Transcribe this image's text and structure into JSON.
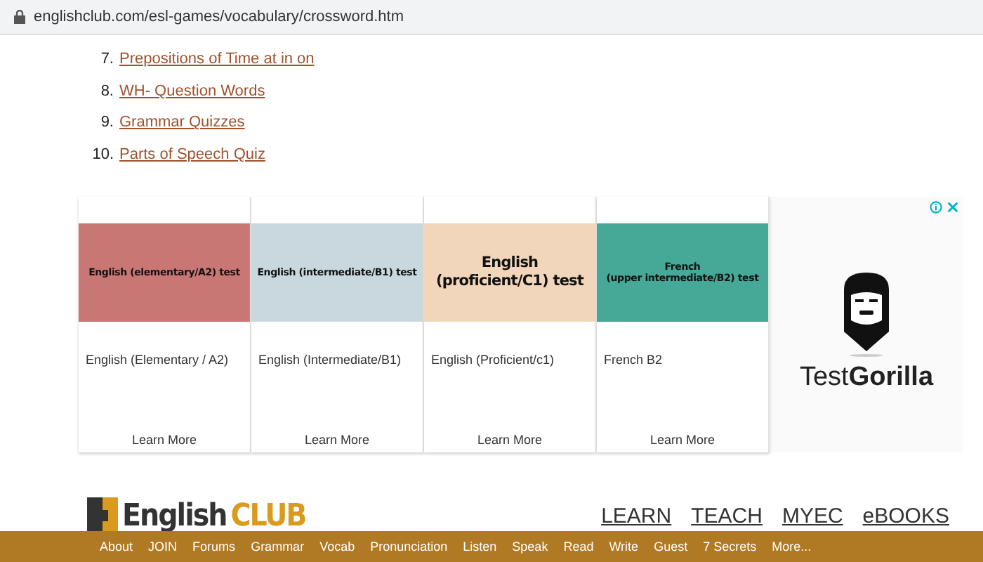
{
  "address_bar": {
    "url": "englishclub.com/esl-games/vocabulary/crossword.htm"
  },
  "list": [
    {
      "number": "7.",
      "link": "Prepositions of Time at in on"
    },
    {
      "number": "8.",
      "link": "WH- Question Words"
    },
    {
      "number": "9.",
      "link": "Grammar Quizzes"
    },
    {
      "number": "10.",
      "link": "Parts of Speech Quiz"
    }
  ],
  "ad": {
    "cards": [
      {
        "banner": "English (elementary/A2) test",
        "kind": "small",
        "color": "#c97775",
        "title": "English (Elementary / A2)",
        "action": "Learn More"
      },
      {
        "banner": "English (intermediate/B1) test",
        "kind": "small",
        "color": "#c8d8de",
        "title": "English (Intermediate/B1)",
        "action": "Learn More"
      },
      {
        "banner": "English\n(proficient/C1) test",
        "kind": "large",
        "color": "#f1d6bb",
        "title": "English (Proficient/c1)",
        "action": "Learn More"
      },
      {
        "banner": "French\n(upper intermediate/B2) test",
        "kind": "small",
        "color": "#46a896",
        "title": "French B2",
        "action": "Learn More"
      }
    ],
    "brand": "Test**Gorilla**"
  },
  "header": {
    "logo_first": "English",
    "logo_second": "CLUB",
    "nav": [
      "LEARN",
      "TEACH",
      "MYEC",
      "eBOOKS"
    ]
  },
  "footer_nav": [
    "About",
    "JOIN",
    "Forums",
    "Grammar",
    "Vocab",
    "Pronunciation",
    "Listen",
    "Speak",
    "Read",
    "Write",
    "Guest",
    "7 Secrets",
    "More..."
  ]
}
